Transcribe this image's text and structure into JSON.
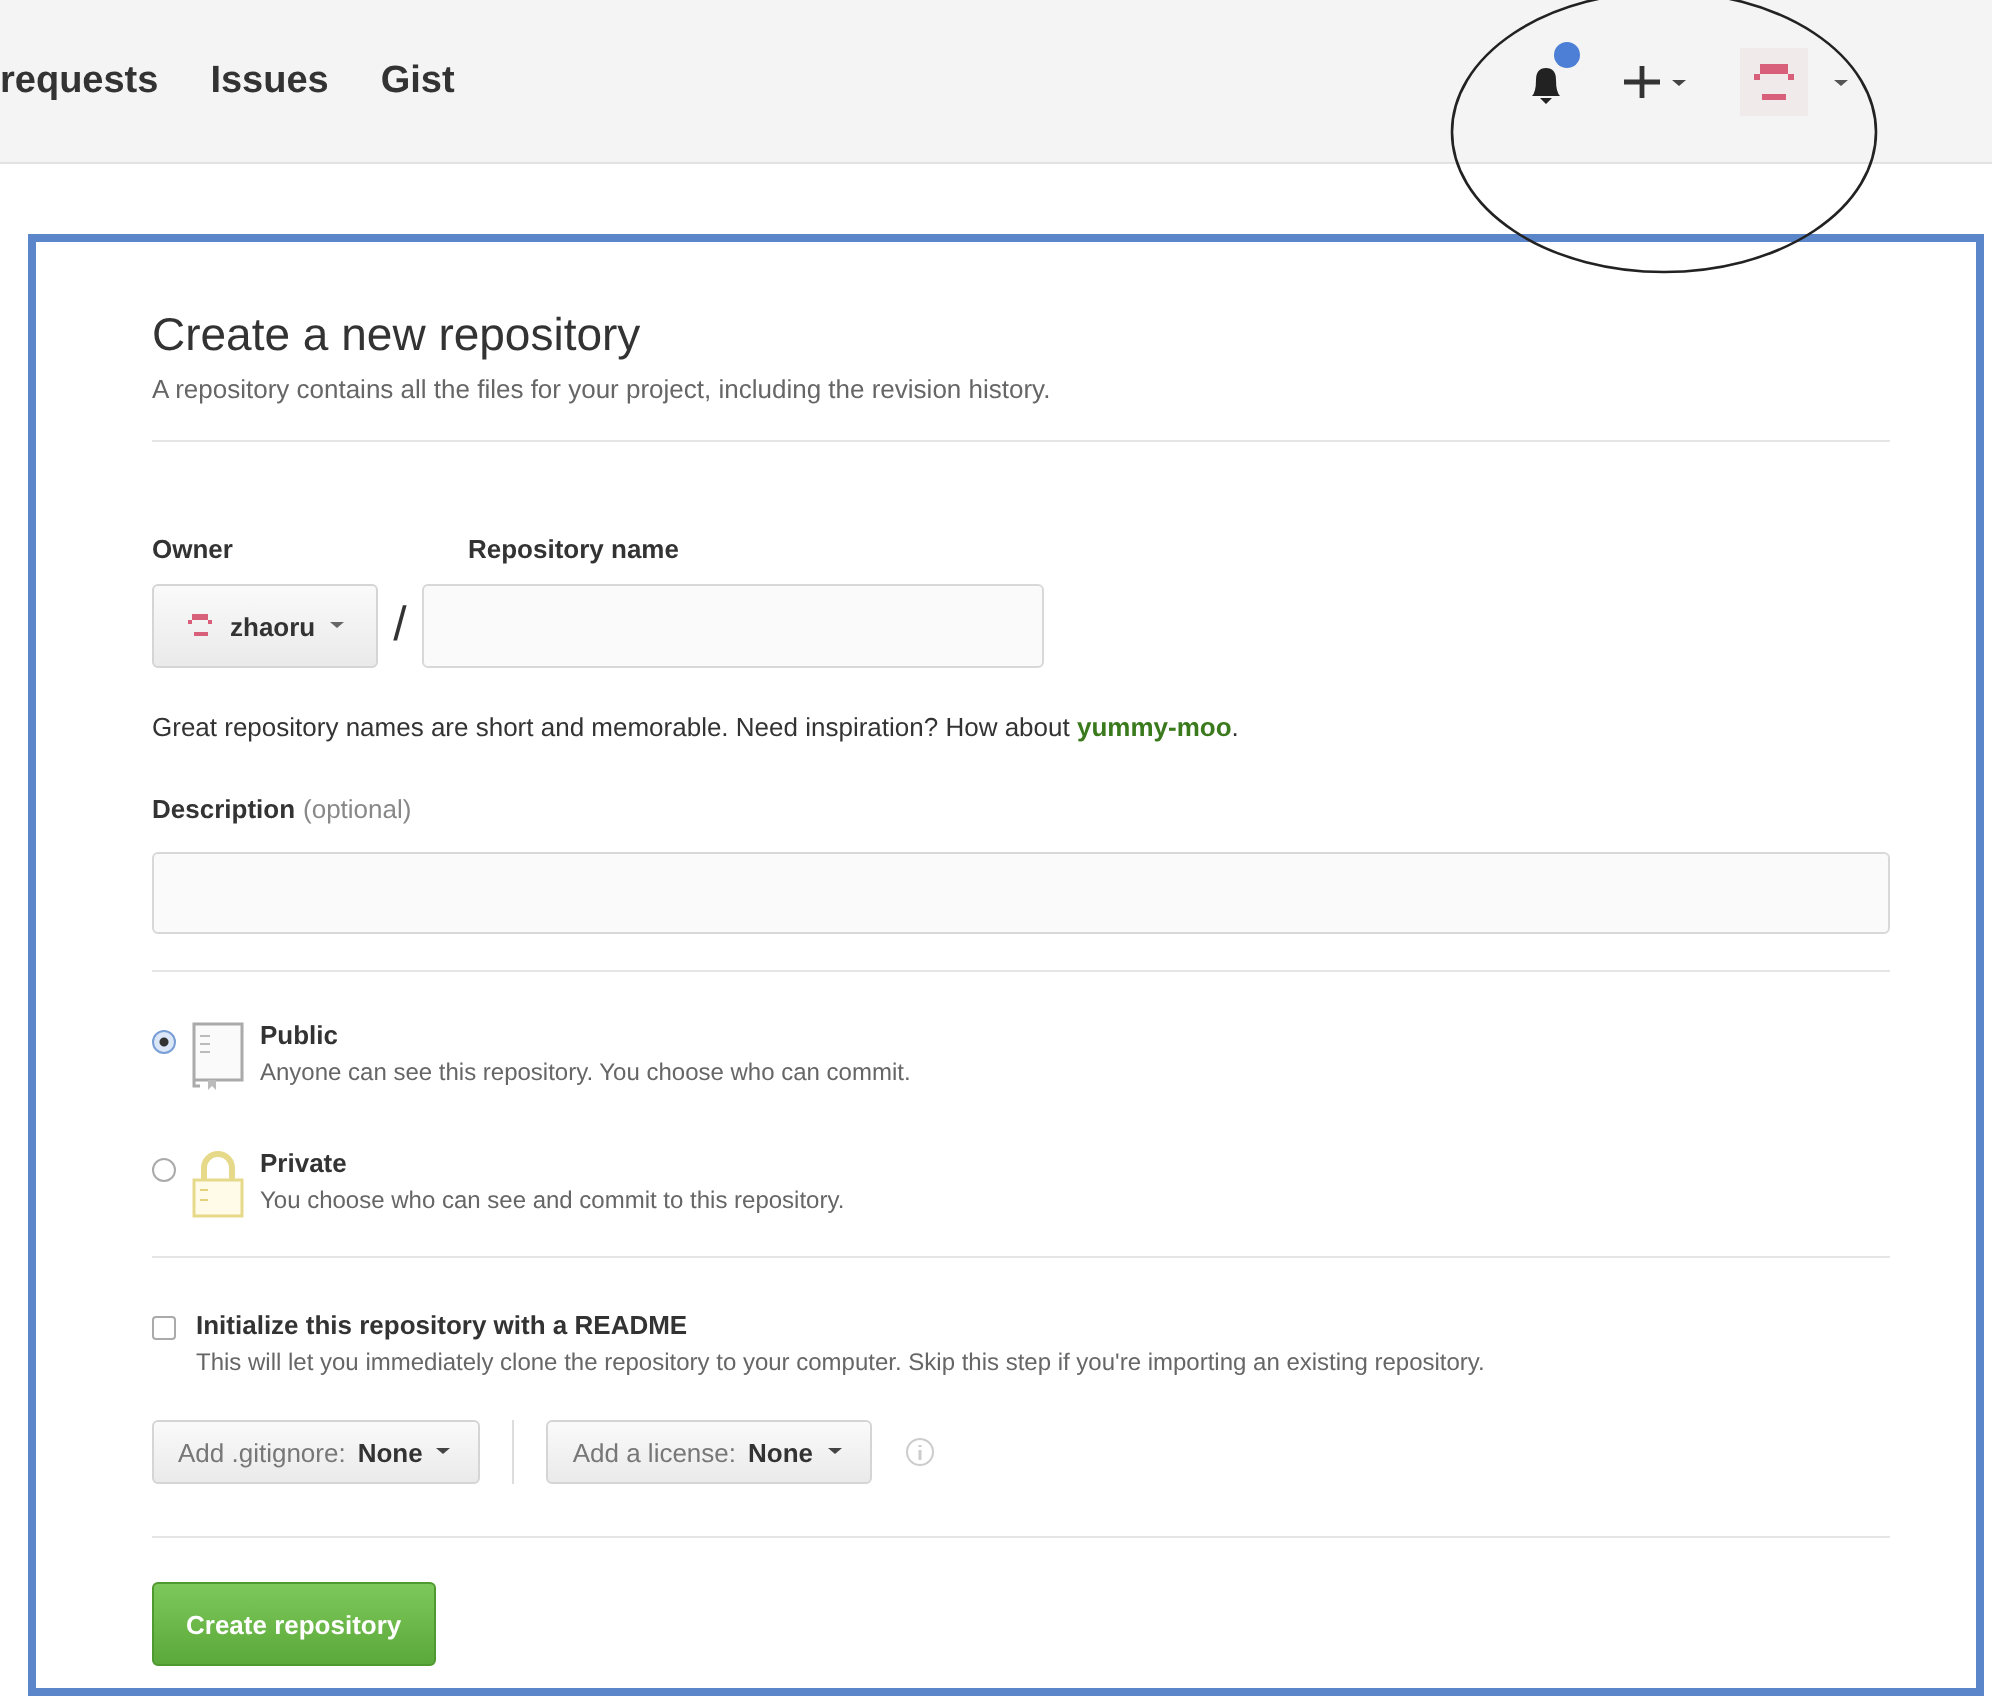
{
  "header": {
    "nav": [
      "requests",
      "Issues",
      "Gist"
    ],
    "notification": {
      "unread": true
    }
  },
  "form": {
    "title": "Create a new repository",
    "subtitle": "A repository contains all the files for your project, including the revision history.",
    "owner_label": "Owner",
    "repo_label": "Repository name",
    "owner": "zhaoru",
    "separator": "/",
    "hint": "Great repository names are short and memorable. Need inspiration? How about ",
    "suggestion": "yummy-moo",
    "hint_end": ".",
    "description_label": "Description",
    "description_note": "(optional)",
    "visibility": [
      {
        "kind": "public",
        "title": "Public",
        "description": "Anyone can see this repository. You choose who can commit.",
        "selected": true
      },
      {
        "kind": "private",
        "title": "Private",
        "description": "You choose who can see and commit to this repository.",
        "selected": false
      }
    ],
    "readme": {
      "label": "Initialize this repository with a README",
      "description": "This will let you immediately clone the repository to your computer. Skip this step if you're importing an existing repository.",
      "checked": false
    },
    "gitignore": {
      "label": "Add .gitignore:",
      "value": "None"
    },
    "license": {
      "label": "Add a license:",
      "value": "None"
    },
    "submit": "Create repository"
  }
}
